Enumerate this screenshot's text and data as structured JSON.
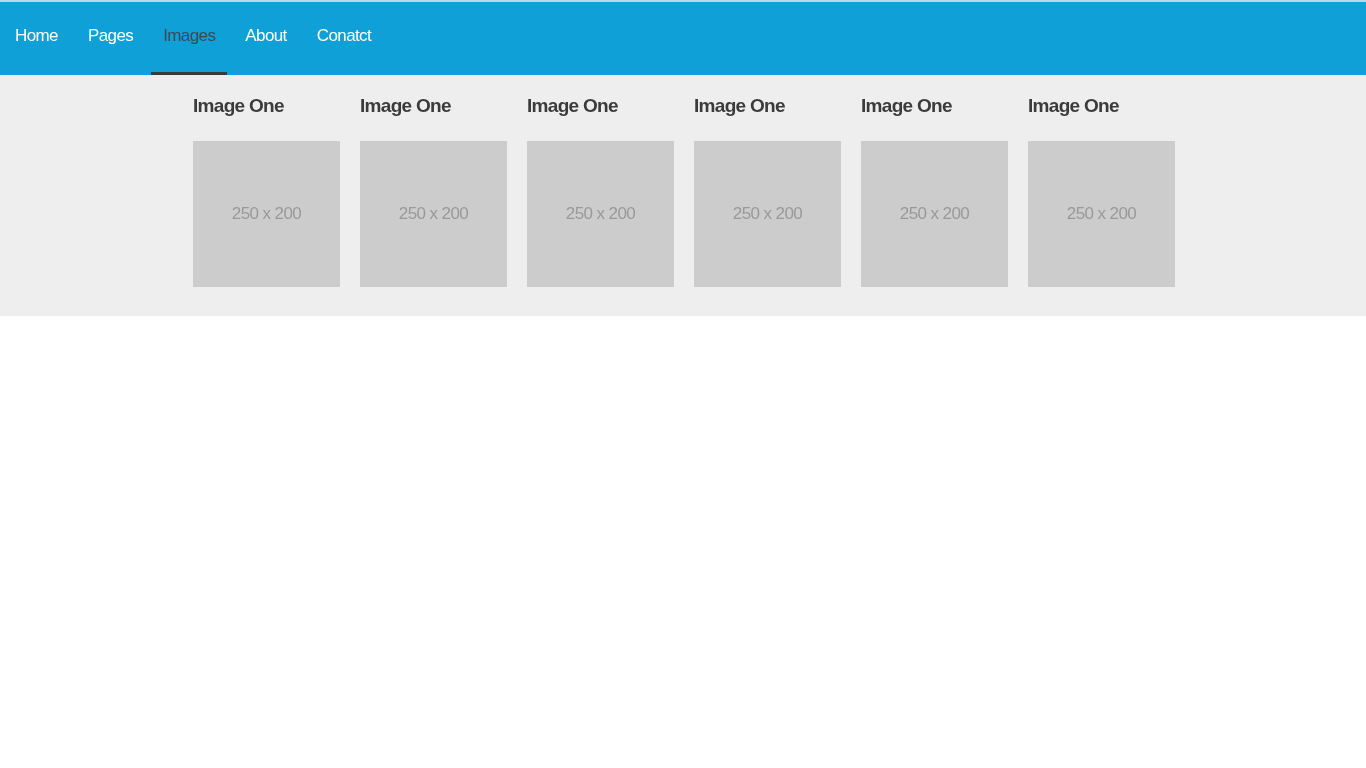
{
  "nav": {
    "items": [
      {
        "label": "Home",
        "selected": false
      },
      {
        "label": "Pages",
        "selected": false
      },
      {
        "label": "Images",
        "selected": true
      },
      {
        "label": "About",
        "selected": false
      },
      {
        "label": "Conatct",
        "selected": false
      }
    ]
  },
  "gallery": [
    {
      "title": "Image One",
      "placeholder_text": "250 x 200"
    },
    {
      "title": "Image One",
      "placeholder_text": "250 x 200"
    },
    {
      "title": "Image One",
      "placeholder_text": "250 x 200"
    },
    {
      "title": "Image One",
      "placeholder_text": "250 x 200"
    },
    {
      "title": "Image One",
      "placeholder_text": "250 x 200"
    },
    {
      "title": "Image One",
      "placeholder_text": "250 x 200"
    }
  ]
}
